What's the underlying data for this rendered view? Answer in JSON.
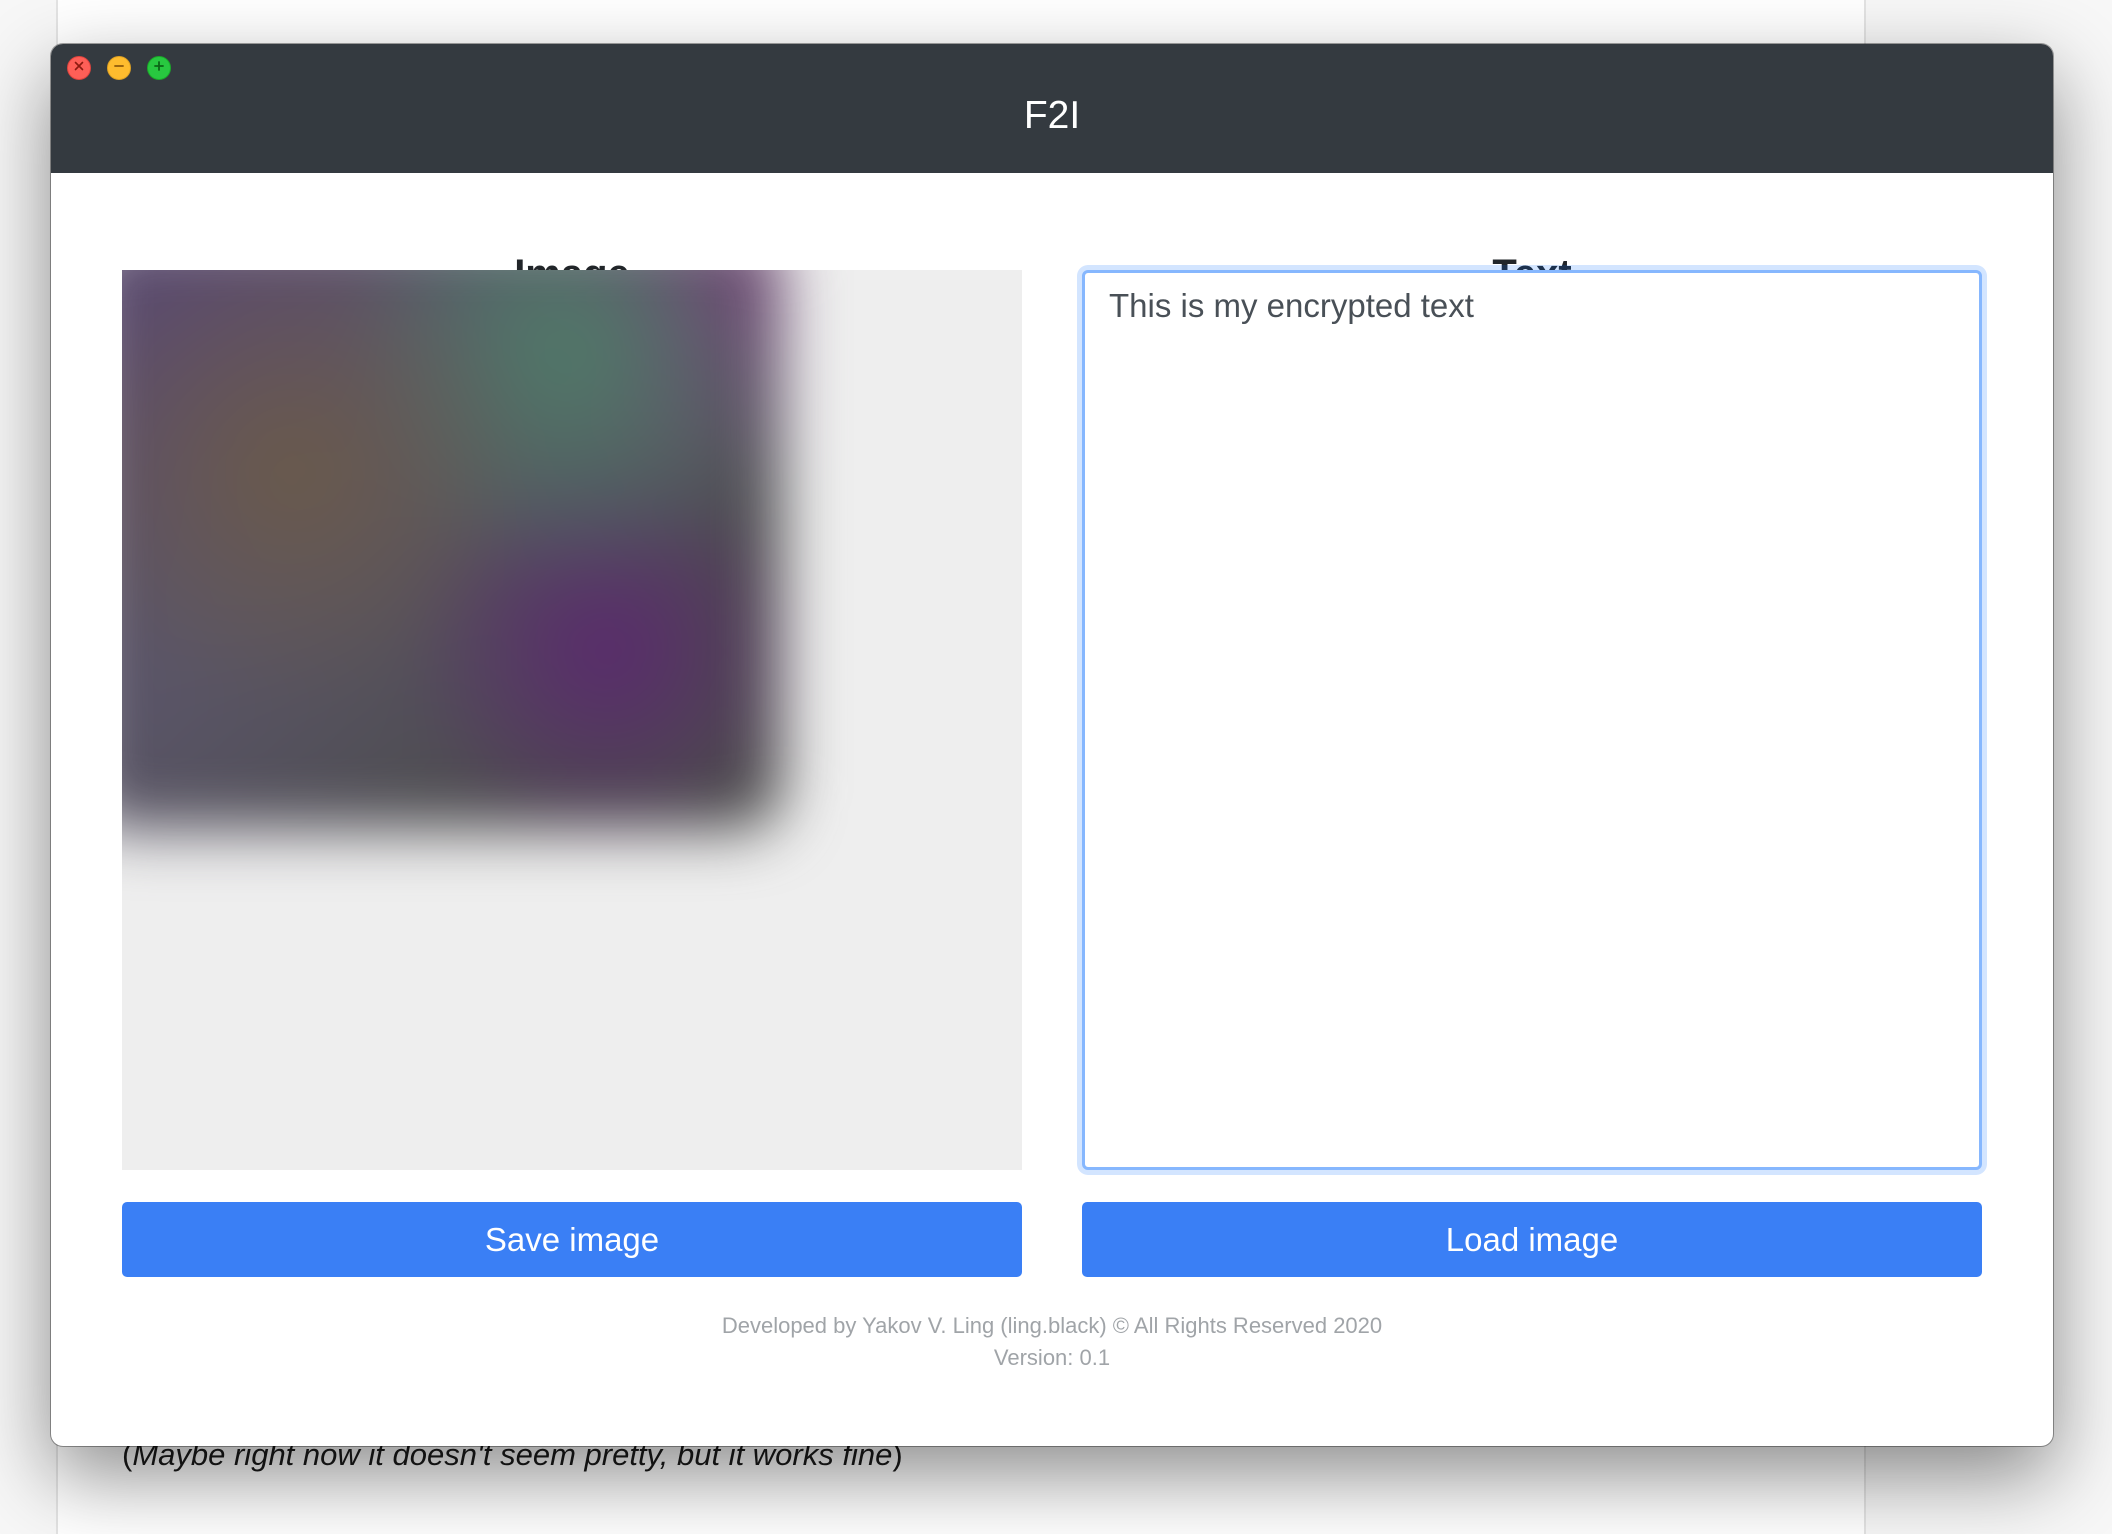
{
  "background": {
    "caption_open": "(",
    "caption_italic": "Maybe right now it doesn't seem pretty, but it works fine",
    "caption_close": ")"
  },
  "window": {
    "title": "F2I",
    "controls": {
      "close_icon": "close-icon",
      "minimize_icon": "minimize-icon",
      "maximize_icon": "maximize-icon"
    }
  },
  "image_panel": {
    "heading": "Image",
    "save_button_label": "Save image"
  },
  "text_panel": {
    "heading": "Text",
    "textarea_value": "This is my encrypted text",
    "load_button_label": "Load image"
  },
  "footer": {
    "credits": "Developed by Yakov V. Ling (ling.black) © All Rights Reserved 2020",
    "version": "Version: 0.1"
  },
  "colors": {
    "titlebar": "#343a40",
    "button": "#3a7ff5",
    "focus_border": "#86b7fe"
  }
}
